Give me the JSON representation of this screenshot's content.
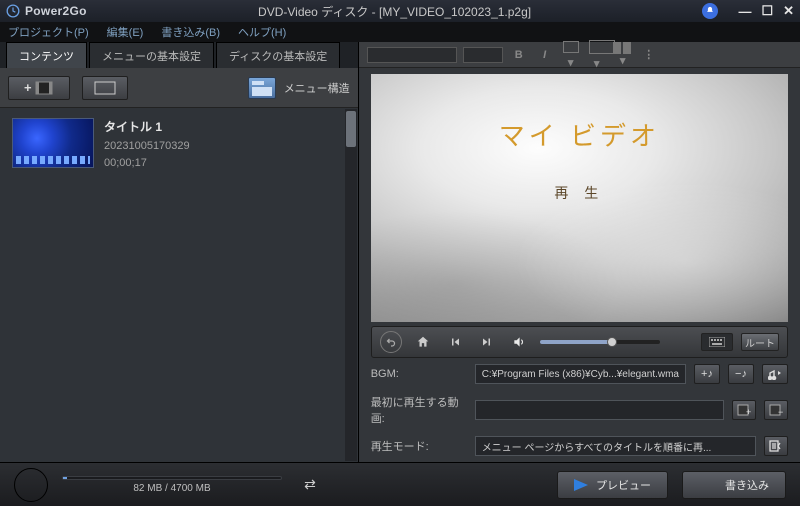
{
  "app": {
    "name": "Power2Go",
    "doc": "DVD-Video ディスク - [MY_VIDEO_102023_1.p2g]"
  },
  "menubar": [
    "プロジェクト(P)",
    "編集(E)",
    "書き込み(B)",
    "ヘルプ(H)"
  ],
  "tabs": [
    {
      "label": "コンテンツ",
      "active": true
    },
    {
      "label": "メニューの基本設定",
      "active": false
    },
    {
      "label": "ディスクの基本設定",
      "active": false
    }
  ],
  "toolbar": {
    "menu_structure": "メニュー構造"
  },
  "clip": {
    "title": "タイトル 1",
    "ts": "20231005170329",
    "dur": "00;00;17"
  },
  "preview": {
    "title": "マイ ビデオ",
    "play": "再 生"
  },
  "transport": {
    "root": "ルート"
  },
  "props": {
    "bgm_label": "BGM:",
    "bgm_value": "C:¥Program Files (x86)¥Cyb...¥elegant.wma",
    "first_label": "最初に再生する動画:",
    "first_value": "",
    "mode_label": "再生モード:",
    "mode_value": "メニュー ページからすべてのタイトルを順番に再..."
  },
  "bottom": {
    "capacity": "82 MB / 4700 MB",
    "preview": "プレビュー",
    "burn": "書き込み"
  }
}
